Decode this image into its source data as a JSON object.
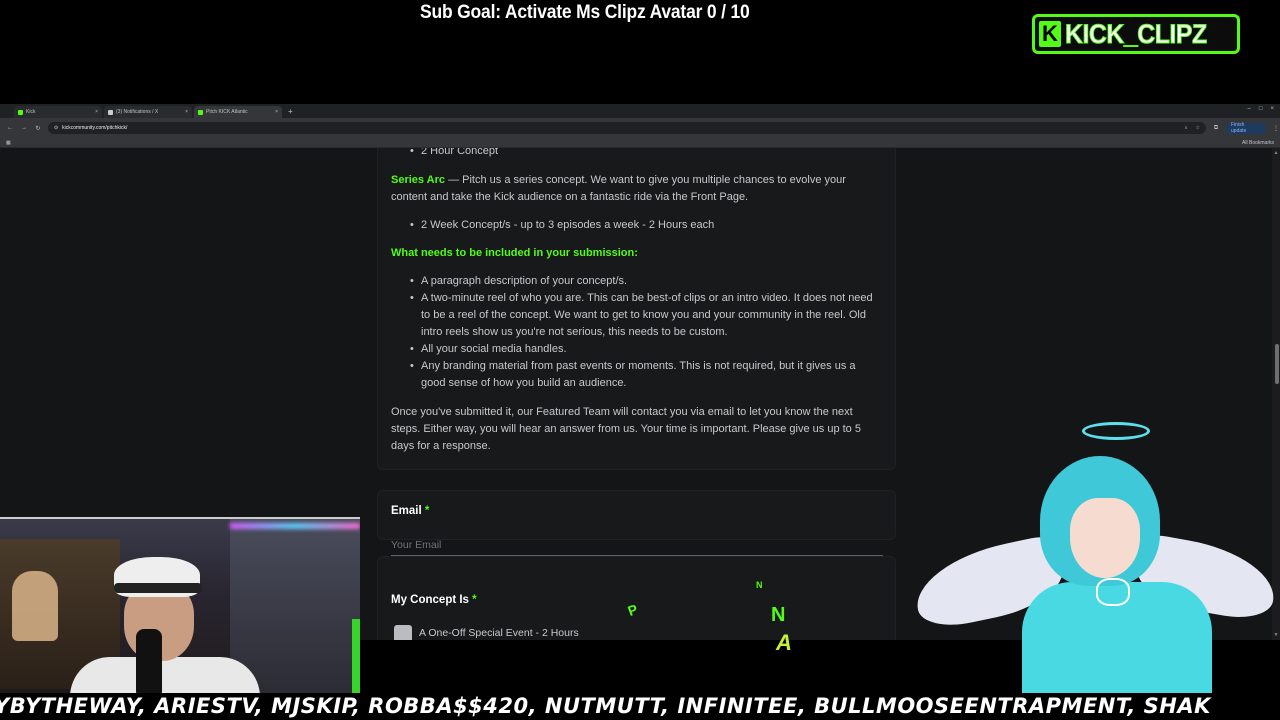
{
  "overlay": {
    "sub_goal": "Sub Goal: Activate Ms Clipz Avatar  0 / 10",
    "logo_k": "K",
    "logo_text": "KICK_CLIPZ",
    "ticker": "YBYTHEWAY, ARIESTV, MJSKIP, ROBBA$$420, NUTMUTT, INFINITEE, BULLMOOSEENTRAPMENT, SHAK",
    "float_n_small": "N",
    "float_n": "N",
    "float_a": "A",
    "float_p": "P"
  },
  "browser": {
    "tabs": [
      {
        "label": "Kick",
        "icon": "kick-icon"
      },
      {
        "label": "(3) Notifications / X",
        "icon": "x-icon"
      },
      {
        "label": "Pitch KICK Atlantic",
        "icon": "kick-icon"
      }
    ],
    "url": "kickcommunity.com/pitchkick/",
    "finish_update": "Finish update",
    "all_bookmarks": "All Bookmarks"
  },
  "page": {
    "bullet_concept": "2 Hour Concept",
    "series_arc_title": "Series Arc",
    "series_arc_text": " — Pitch us a series concept. We want to give you multiple chances to evolve your content and take the Kick audience on a fantastic ride via the Front Page.",
    "series_bullet": "2 Week Concept/s - up to 3 episodes a week - 2 Hours each",
    "submission_heading": "What needs to be included in your submission:",
    "submission_items": [
      "A paragraph description of your concept/s.",
      "A two-minute reel of who you are. This can be best-of clips or an intro video. It does not need to be a reel of the concept. We want to get to know you and your community in the reel. Old intro reels show us you're not serious, this needs to be custom.",
      "All your social media handles.",
      "Any branding material from past events or moments. This is not required, but it gives us a good sense of how you build an audience."
    ],
    "closing_text": "Once you've submitted it, our Featured Team will contact you via email to let you know the next steps. Either way, you will hear an answer from us. Your time is important. Please give us up to 5 days for a response.",
    "email_label": "Email",
    "required_mark": "*",
    "email_placeholder": "Your Email",
    "concept_label": "My Concept Is",
    "concept_option_1": "A One-Off Special Event - 2 Hours"
  },
  "colors": {
    "kick_green": "#53fc18",
    "page_bg": "#141517",
    "card_bg": "#18191b"
  }
}
